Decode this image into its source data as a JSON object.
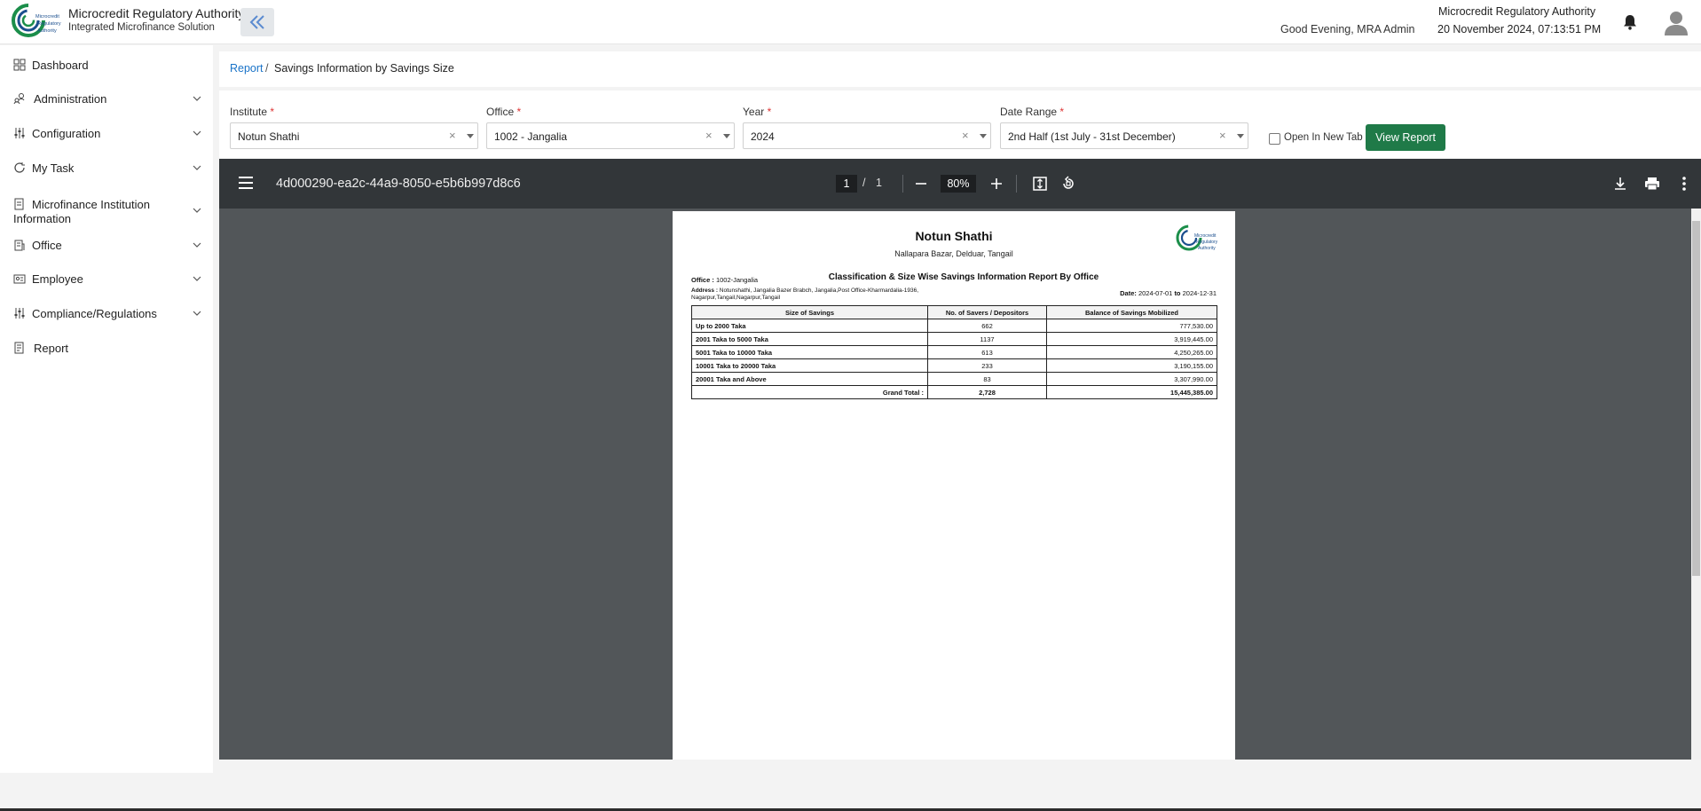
{
  "header": {
    "org_name": "Microcredit Regulatory Authority",
    "org_sub": "Integrated Microfinance Solution",
    "logo_text": "Microcredit Regulatory Authority",
    "greeting": "Good Evening, MRA Admin",
    "right_org": "Microcredit Regulatory Authority",
    "datetime": "20 November 2024, 07:13:51 PM",
    "icons": {
      "collapse": "double-chevron-left-icon",
      "notifications": "bell-icon",
      "avatar": "user-avatar-icon"
    }
  },
  "sidebar": {
    "items": [
      {
        "label": "Dashboard",
        "icon": "dashboard-icon"
      },
      {
        "label": "Administration",
        "icon": "users-icon"
      },
      {
        "label": "Configuration",
        "icon": "sliders-icon"
      },
      {
        "label": "My Task",
        "icon": "refresh-icon"
      },
      {
        "label_line1": "Microfinance Institution",
        "label_line2": "Information",
        "icon": "document-icon"
      },
      {
        "label": "Office",
        "icon": "building-icon"
      },
      {
        "label": "Employee",
        "icon": "id-card-icon"
      },
      {
        "label": "Compliance/Regulations",
        "icon": "sliders-icon"
      },
      {
        "label": "Report",
        "icon": "report-icon"
      }
    ]
  },
  "breadcrumb": {
    "root": "Report",
    "separator": "/",
    "current": "Savings Information by Savings Size"
  },
  "filters": {
    "institute": {
      "label": "Institute",
      "value": "Notun Shathi"
    },
    "office": {
      "label": "Office",
      "value": "1002 - Jangalia"
    },
    "year": {
      "label": "Year",
      "value": "2024"
    },
    "date_range": {
      "label": "Date Range",
      "value": "2nd Half (1st July - 31st December)"
    },
    "required_mark": "*",
    "open_new_tab_label": "Open In New Tab",
    "view_report_label": "View Report"
  },
  "viewer": {
    "file_name": "4d000290-ea2c-44a9-8050-e5b6b997d8c6",
    "current_page": "1",
    "page_sep": "/",
    "total_pages": "1",
    "zoom": "80%"
  },
  "report": {
    "org_title": "Notun Shathi",
    "org_address": "Nallapara Bazar, Delduar, Tangail",
    "heading": "Classification & Size Wise Savings Information Report By Office",
    "office_label": "Office :",
    "office_value": "1002-Jangalia",
    "address_label": "Address :",
    "address_value": "Notunshathi, Jangalia Bazer Brabch, Jangalia,Post Office-Kharmardalia-1936, Nagarpur,Tangail,Nagarpur,Tangail",
    "date_label": "Date:",
    "date_from": "2024-07-01",
    "date_to_label": "to",
    "date_to": "2024-12-31",
    "columns": [
      "Size of Savings",
      "No. of Savers / Depositors",
      "Balance of Savings Mobilized"
    ],
    "rows": [
      {
        "size": "Up to 2000 Taka",
        "savers": "662",
        "balance": "777,530.00"
      },
      {
        "size": "2001 Taka to 5000 Taka",
        "savers": "1137",
        "balance": "3,919,445.00"
      },
      {
        "size": "5001 Taka to 10000 Taka",
        "savers": "613",
        "balance": "4,250,265.00"
      },
      {
        "size": "10001 Taka to 20000 Taka",
        "savers": "233",
        "balance": "3,190,155.00"
      },
      {
        "size": "20001 Taka and Above",
        "savers": "83",
        "balance": "3,307,990.00"
      }
    ],
    "total": {
      "label": "Grand Total :",
      "savers": "2,728",
      "balance": "15,445,385.00"
    }
  },
  "colors": {
    "accent_green": "#1f7a48",
    "link_blue": "#1a73c8",
    "viewer_bg": "#525659",
    "toolbar_bg": "#323639"
  }
}
